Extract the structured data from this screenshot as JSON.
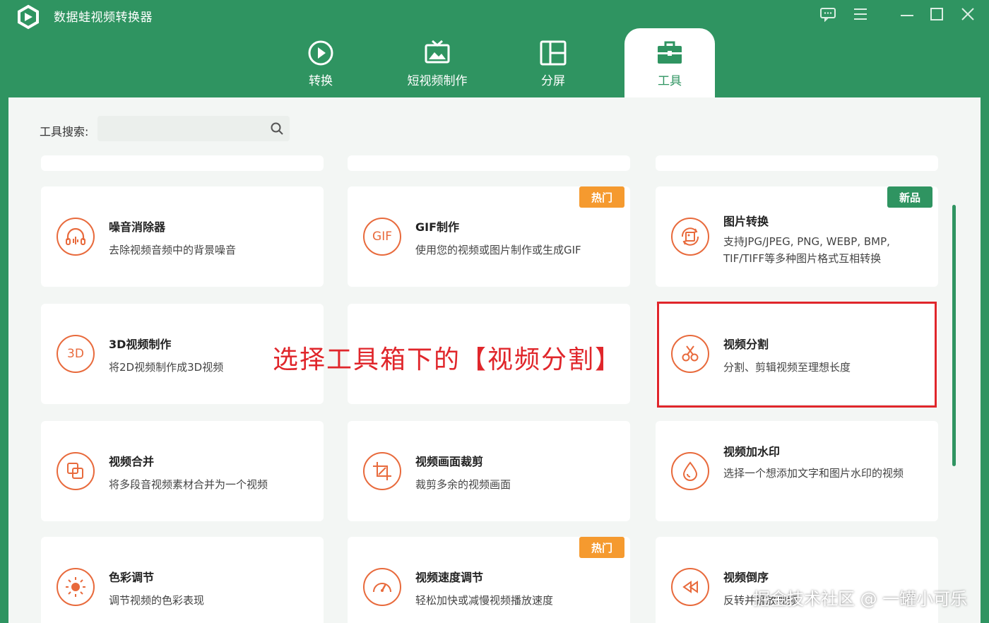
{
  "app": {
    "title": "数据蛙视频转换器"
  },
  "nav": {
    "tabs": [
      {
        "label": "转换",
        "icon": "convert-icon"
      },
      {
        "label": "短视频制作",
        "icon": "short-video-icon"
      },
      {
        "label": "分屏",
        "icon": "split-screen-icon"
      },
      {
        "label": "工具",
        "icon": "toolbox-icon"
      }
    ],
    "active": "工具"
  },
  "search": {
    "label": "工具搜索:",
    "value": ""
  },
  "tools": [
    {
      "title": "噪音消除器",
      "desc": "去除视频音频中的背景噪音",
      "icon": "headphones-icon",
      "badge": ""
    },
    {
      "title": "GIF制作",
      "desc": "使用您的视频或图片制作或生成GIF",
      "icon": "gif-icon",
      "icon_text": "GIF",
      "badge": "热门"
    },
    {
      "title": "图片转换",
      "desc": "支持JPG/JPEG, PNG, WEBP, BMP, TIF/TIFF等多种图片格式互相转换",
      "icon": "image-convert-icon",
      "badge": "新品"
    },
    {
      "title": "3D视频制作",
      "desc": "将2D视频制作成3D视频",
      "icon": "3d-icon",
      "icon_text": "3D",
      "badge": ""
    },
    {
      "title": "",
      "desc": "",
      "icon": "",
      "badge": ""
    },
    {
      "title": "视频分割",
      "desc": "分割、剪辑视频至理想长度",
      "icon": "scissors-icon",
      "badge": ""
    },
    {
      "title": "视频合并",
      "desc": "将多段音视频素材合并为一个视频",
      "icon": "merge-icon",
      "badge": ""
    },
    {
      "title": "视频画面裁剪",
      "desc": "裁剪多余的视频画面",
      "icon": "crop-icon",
      "badge": ""
    },
    {
      "title": "视频加水印",
      "desc": "选择一个想添加文字和图片水印的视频",
      "icon": "watermark-drop-icon",
      "badge": ""
    },
    {
      "title": "色彩调节",
      "desc": "调节视频的色彩表现",
      "icon": "color-sun-icon",
      "badge": ""
    },
    {
      "title": "视频速度调节",
      "desc": "轻松加快或减慢视频播放速度",
      "icon": "speedometer-icon",
      "badge": "热门"
    },
    {
      "title": "视频倒序",
      "desc": "反转并播放视频",
      "icon": "rewind-icon",
      "badge": ""
    }
  ],
  "annotation": {
    "text": "选择工具箱下的【视频分割】"
  },
  "watermark": {
    "text": "掘金技术社区 @ 一罐小可乐"
  },
  "colors": {
    "brand": "#2f9461",
    "accent": "#e86a3c",
    "hot": "#f59a2f",
    "highlight": "#e0262b"
  }
}
